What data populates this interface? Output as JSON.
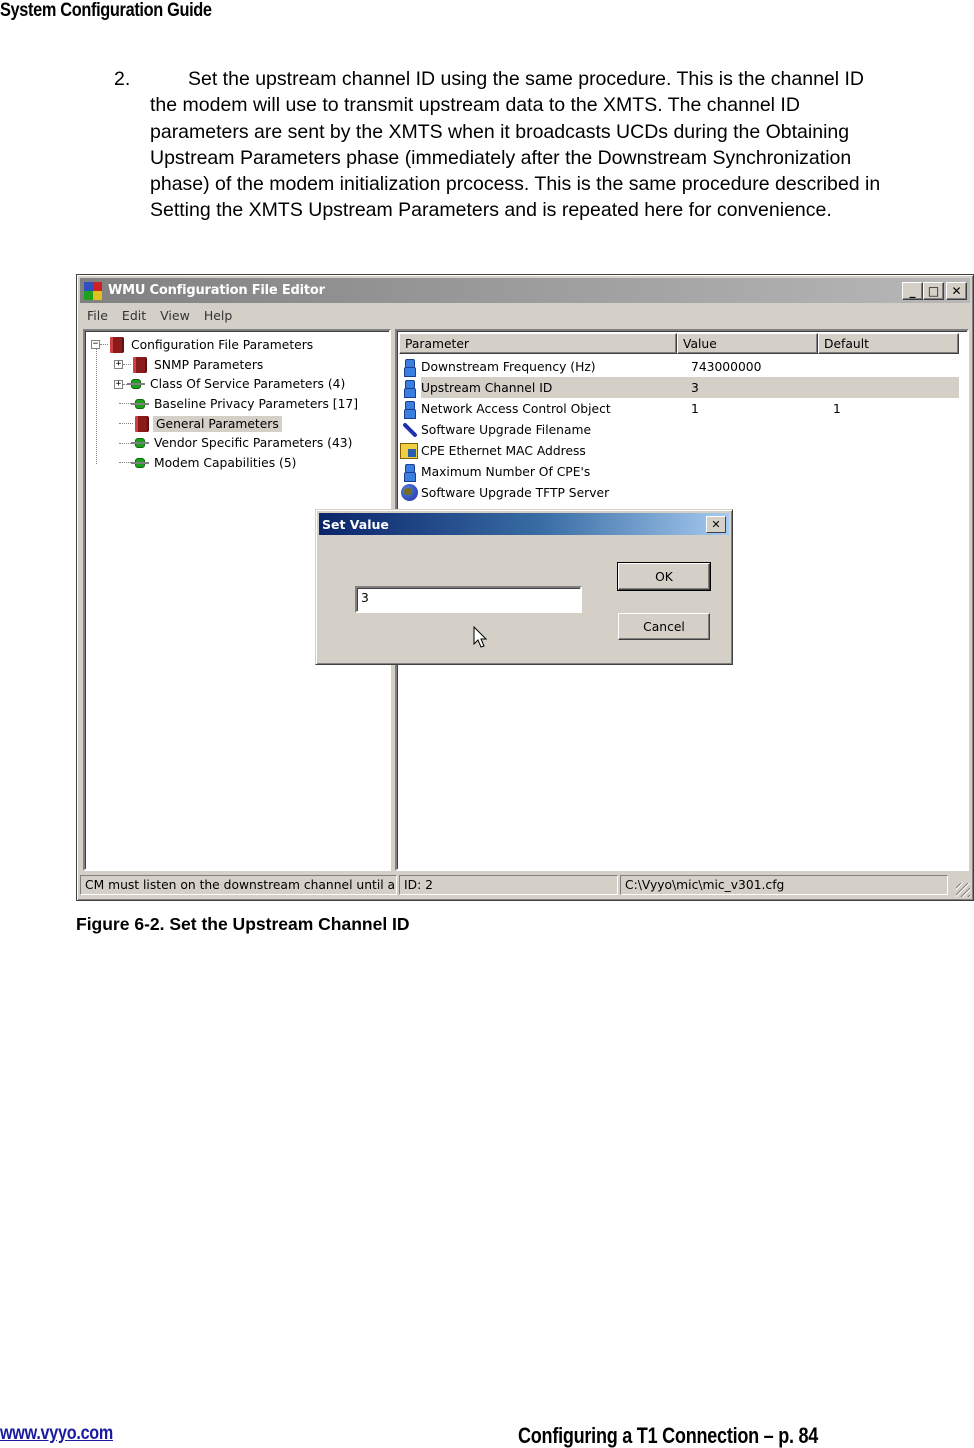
{
  "doc": {
    "header": "System Configuration Guide",
    "step_number": "2.",
    "step_text": "Set the upstream channel ID using the same procedure.  This is the channel ID the modem will use to transmit upstream data to the XMTS. The channel ID parameters are sent by the XMTS when it broadcasts UCDs during the Obtaining Upstream Parameters phase (immediately after the Downstream Synchronization phase) of the modem initialization prcocess. This is the same procedure described in Setting the XMTS Upstream Parameters and is repeated here for convenience.",
    "figure_caption": "Figure 6-2. Set the Upstream Channel ID",
    "footer_link": "www.vyyo.com",
    "footer_page": "Configuring a T1 Connection – p. 84"
  },
  "window": {
    "title": "WMU Configuration File Editor",
    "controls": {
      "minimize": "_",
      "maximize": "□",
      "close": "✕"
    },
    "menu": [
      "File",
      "Edit",
      "View",
      "Help"
    ],
    "tree": [
      {
        "label": "Configuration File Parameters",
        "icon": "book-icon",
        "expander": "−",
        "level": 0
      },
      {
        "label": "SNMP Parameters",
        "icon": "book-icon",
        "expander": "+",
        "level": 1
      },
      {
        "label": "Class Of Service Parameters (4)",
        "icon": "network-node-icon",
        "expander": "+",
        "level": 1
      },
      {
        "label": "Baseline Privacy Parameters [17]",
        "icon": "network-node-icon",
        "expander": "",
        "level": 1
      },
      {
        "label": "General Parameters",
        "icon": "book-icon",
        "expander": "",
        "level": 1,
        "selected": true
      },
      {
        "label": "Vendor Specific Parameters (43)",
        "icon": "network-node-icon",
        "expander": "",
        "level": 1
      },
      {
        "label": "Modem Capabilities (5)",
        "icon": "network-node-icon",
        "expander": "",
        "level": 1
      }
    ],
    "list": {
      "columns": [
        "Parameter",
        "Value",
        "Default"
      ],
      "rows": [
        {
          "icon": "person-icon",
          "parameter": "Downstream Frequency  (Hz)",
          "value": "743000000",
          "default": ""
        },
        {
          "icon": "person-icon",
          "parameter": "Upstream Channel ID",
          "value": "3",
          "default": "",
          "selected": true
        },
        {
          "icon": "person-icon",
          "parameter": "Network Access Control Object",
          "value": "1",
          "default": "1"
        },
        {
          "icon": "pen-icon",
          "parameter": "Software Upgrade Filename",
          "value": "",
          "default": ""
        },
        {
          "icon": "folder-icon",
          "parameter": "CPE Ethernet MAC Address",
          "value": "",
          "default": ""
        },
        {
          "icon": "person-icon",
          "parameter": "Maximum Number Of CPE's",
          "value": "",
          "default": ""
        },
        {
          "icon": "globe-icon",
          "parameter": "Software Upgrade TFTP Server",
          "value": "",
          "default": ""
        }
      ]
    },
    "status": {
      "message": "CM must listen on the downstream channel until an ups",
      "id": "ID: 2",
      "file": "C:\\Vyyo\\mic\\mic_v301.cfg"
    }
  },
  "dialog": {
    "title": "Set Value",
    "close": "✕",
    "input_value": "3",
    "ok_label": "OK",
    "cancel_label": "Cancel"
  }
}
